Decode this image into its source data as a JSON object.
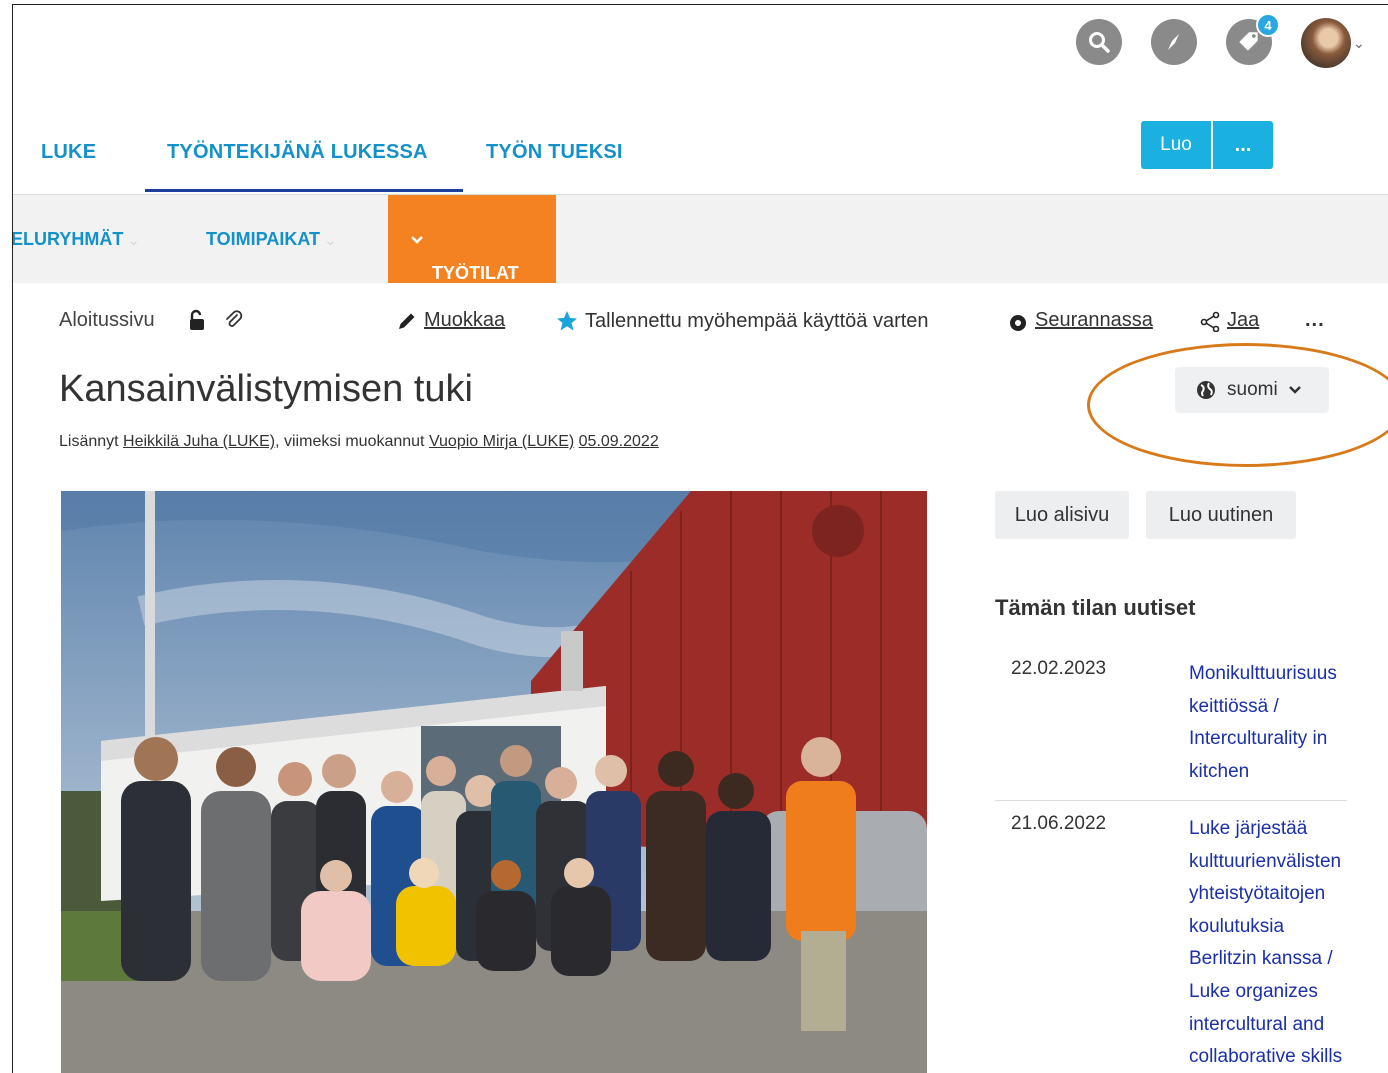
{
  "header": {
    "notification_count": "4",
    "icons": [
      "search-icon",
      "compass-icon",
      "tags-icon",
      "avatar"
    ]
  },
  "main_nav": {
    "items": [
      {
        "label": "LUKE"
      },
      {
        "label": "TYÖNTEKIJÄNÄ LUKESSA",
        "active": true
      },
      {
        "label": "TYÖN TUEKSI"
      }
    ],
    "create_label": "Luo",
    "more_label": "..."
  },
  "sub_nav": {
    "items": [
      {
        "label": "ELURYHMÄT"
      },
      {
        "label": "TOIMIPAIKAT"
      },
      {
        "label": "TYÖTILAT",
        "active": true
      }
    ]
  },
  "toolbar": {
    "breadcrumb": "Aloitussivu",
    "edit_label": "Muokkaa",
    "saved_label": "Tallennettu myöhempää käyttöä varten",
    "following_label": "Seurannassa",
    "share_label": "Jaa",
    "more_label": "..."
  },
  "page": {
    "title": "Kansainvälistymisen tuki",
    "meta_prefix": "Lisännyt ",
    "author": "Heikkilä Juha (LUKE)",
    "meta_middle": ", viimeksi muokannut ",
    "editor": "Vuopio Mirja (LUKE)",
    "date": "05.09.2022",
    "language": "suomi"
  },
  "sidebar": {
    "create_subpage_label": "Luo alisivu",
    "create_news_label": "Luo uutinen",
    "news_heading": "Tämän tilan uutiset",
    "news": [
      {
        "date": "22.02.2023",
        "lines": [
          "Monikulttuurisuus",
          "keittiössä /",
          "Interculturality in",
          "kitchen"
        ]
      },
      {
        "date": "21.06.2022",
        "lines": [
          "Luke järjestää",
          "kulttuurienvälisten",
          "yhteistyötaitojen",
          "koulutuksia",
          "Berlitzin kanssa /",
          "Luke organizes",
          "intercultural and",
          "collaborative skills"
        ]
      }
    ]
  },
  "colors": {
    "nav_blue": "#1591c9",
    "active_orange": "#f58220",
    "button_blue": "#1ab0e0",
    "link_dark_blue": "#1a2fa8",
    "annotation_orange": "#d97a1a"
  }
}
